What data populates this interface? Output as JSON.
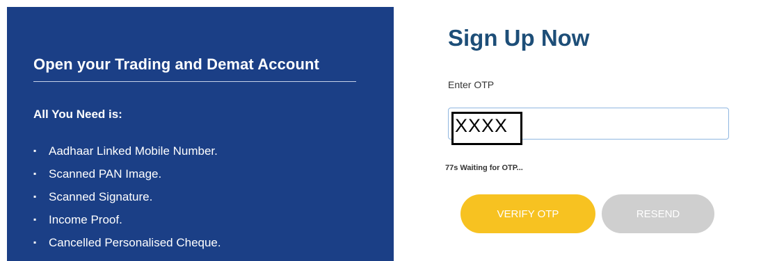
{
  "left": {
    "title": "Open your Trading and Demat Account",
    "subtitle": "All You Need is:",
    "bullet": "▪",
    "items": [
      "Aadhaar Linked Mobile Number.",
      "Scanned PAN Image.",
      "Scanned Signature.",
      "Income Proof.",
      "Cancelled Personalised Cheque."
    ]
  },
  "signup": {
    "title": "Sign Up Now",
    "otp_label": "Enter OTP",
    "otp_value": "XXXX",
    "wait_text": "77s Waiting for OTP...",
    "verify_label": "VERIFY OTP",
    "resend_label": "RESEND"
  },
  "colors": {
    "panel_bg": "#1b3f86",
    "title_color": "#1d4e78",
    "verify_bg": "#f7c221",
    "resend_bg": "#cfcfcf"
  }
}
